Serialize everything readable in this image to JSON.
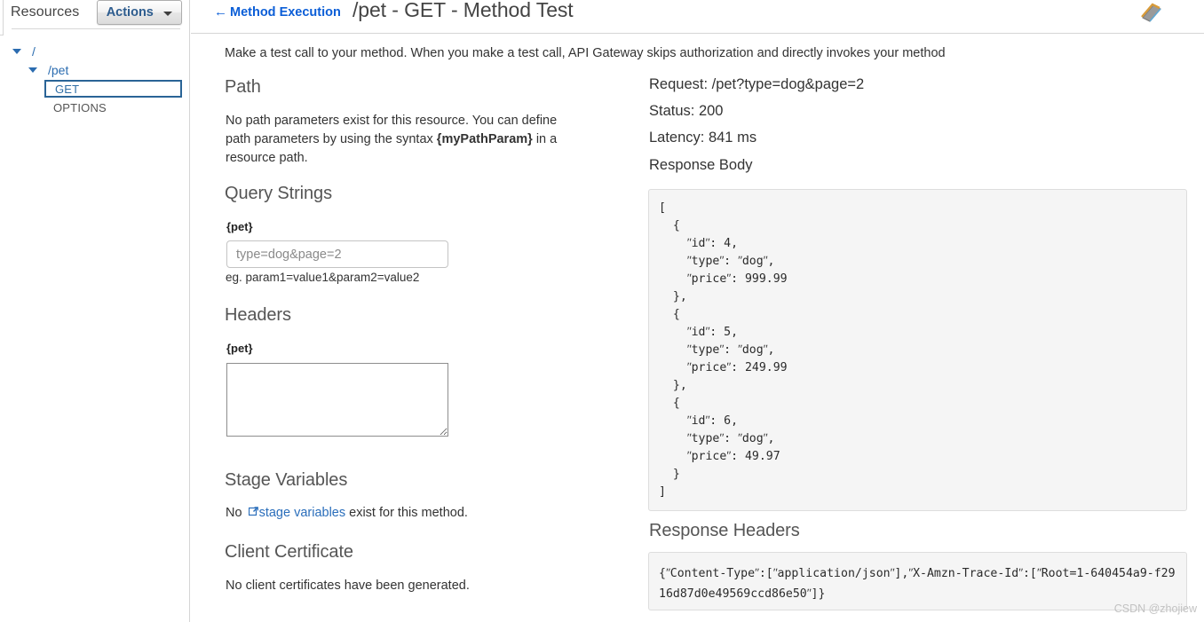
{
  "sidebar": {
    "title": "Resources",
    "actions_label": "Actions",
    "tree": [
      {
        "label": "/",
        "type": "resource",
        "expanded": true
      },
      {
        "label": "/pet",
        "type": "resource",
        "expanded": true
      },
      {
        "label": "GET",
        "type": "method",
        "selected": true
      },
      {
        "label": "OPTIONS",
        "type": "method",
        "selected": false
      }
    ]
  },
  "topbar": {
    "back_link": "Method Execution",
    "back_arrow": "←",
    "title": "/pet - GET - Method Test",
    "docs_icon": "book-icon"
  },
  "main": {
    "intro": "Make a test call to your method. When you make a test call, API Gateway skips authorization and directly invokes your method",
    "path": {
      "heading": "Path",
      "description_1": "No path parameters exist for this resource. You can define path",
      "description_2": "parameters by using the syntax ",
      "param_token": "{myPathParam}",
      "description_3": " in a resource",
      "description_4": "path."
    },
    "query_strings": {
      "heading": "Query Strings",
      "field_label": "{pet}",
      "value": "type=dog&page=2",
      "placeholder": "type=dog&page=2",
      "hint": "eg. param1=value1&param2=value2"
    },
    "headers": {
      "heading": "Headers",
      "field_label": "{pet}",
      "value": "",
      "placeholder": ""
    },
    "stage_variables": {
      "heading": "Stage Variables",
      "text_before": "No ",
      "link_text": "stage variables",
      "text_after": " exist for this method."
    },
    "client_certificate": {
      "heading": "Client Certificate",
      "text": "No client certificates have been generated."
    }
  },
  "result": {
    "request_label": "Request: /pet?type=dog&page=2",
    "status_label": "Status: 200",
    "latency_label": "Latency: 841 ms",
    "response_body_heading": "Response Body",
    "response_body": "[\n  {\n    ʺidʺ: 4,\n    ʺtypeʺ: ʺdogʺ,\n    ʺpriceʺ: 999.99\n  },\n  {\n    ʺidʺ: 5,\n    ʺtypeʺ: ʺdogʺ,\n    ʺpriceʺ: 249.99\n  },\n  {\n    ʺidʺ: 6,\n    ʺtypeʺ: ʺdogʺ,\n    ʺpriceʺ: 49.97\n  }\n]",
    "response_headers_heading": "Response Headers",
    "response_headers": "{ʺContent-Typeʺ:[ʺapplication/jsonʺ],ʺX-Amzn-Trace-Idʺ:[ʺRoot=1-640454a9-f2916d87d0e49569ccd86e50ʺ]}"
  },
  "watermark": "CSDN @zhojiew",
  "colors": {
    "link_blue": "#2b6cb0",
    "title_gray": "#555555",
    "code_bg": "#f5f5f5",
    "selected_border": "#2a6496"
  }
}
